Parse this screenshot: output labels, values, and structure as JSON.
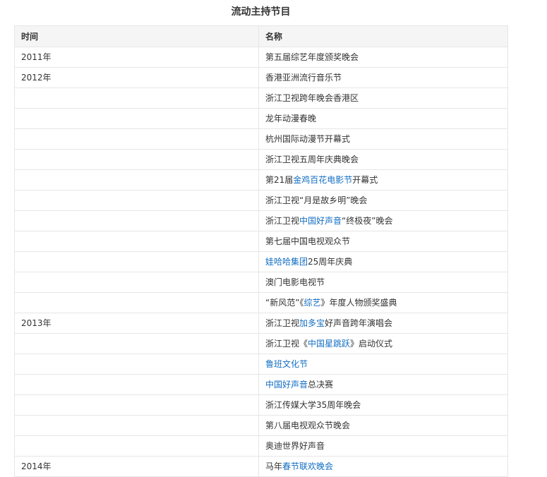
{
  "title": "流动主持节目",
  "headers": {
    "time": "时间",
    "name": "名称"
  },
  "colors": {
    "link": "#136ec2",
    "header_bg": "#f5f5f5",
    "border": "#e6e6e6"
  },
  "rows": [
    {
      "time": "2011年",
      "parts": [
        {
          "text": "第五届综艺年度颁奖晚会"
        }
      ]
    },
    {
      "time": "2012年",
      "parts": [
        {
          "text": "香港亚洲流行音乐节"
        }
      ]
    },
    {
      "time": "",
      "parts": [
        {
          "text": "浙江卫视跨年晚会香港区"
        }
      ]
    },
    {
      "time": "",
      "parts": [
        {
          "text": "龙年动漫春晚"
        }
      ]
    },
    {
      "time": "",
      "parts": [
        {
          "text": "杭州国际动漫节开幕式"
        }
      ]
    },
    {
      "time": "",
      "parts": [
        {
          "text": "浙江卫视五周年庆典晚会"
        }
      ]
    },
    {
      "time": "",
      "parts": [
        {
          "text": "第21届"
        },
        {
          "text": "金鸡百花电影节",
          "link": true
        },
        {
          "text": "开幕式"
        }
      ]
    },
    {
      "time": "",
      "parts": [
        {
          "text": "浙江卫视“月是故乡明”晚会"
        }
      ]
    },
    {
      "time": "",
      "parts": [
        {
          "text": "浙江卫视"
        },
        {
          "text": "中国好声音",
          "link": true
        },
        {
          "text": "“终极夜”晚会"
        }
      ]
    },
    {
      "time": "",
      "parts": [
        {
          "text": "第七届中国电视观众节"
        }
      ]
    },
    {
      "time": "",
      "parts": [
        {
          "text": "娃哈哈集团",
          "link": true
        },
        {
          "text": "25周年庆典"
        }
      ]
    },
    {
      "time": "",
      "parts": [
        {
          "text": "澳门电影电视节"
        }
      ]
    },
    {
      "time": "",
      "parts": [
        {
          "text": "“新风范”《"
        },
        {
          "text": "综艺",
          "link": true
        },
        {
          "text": "》年度人物颁奖盛典"
        }
      ]
    },
    {
      "time": "2013年",
      "parts": [
        {
          "text": "浙江卫视"
        },
        {
          "text": "加多宝",
          "link": true
        },
        {
          "text": "好声音跨年演唱会"
        }
      ]
    },
    {
      "time": "",
      "parts": [
        {
          "text": "浙江卫视《"
        },
        {
          "text": "中国星跳跃",
          "link": true
        },
        {
          "text": "》启动仪式"
        }
      ]
    },
    {
      "time": "",
      "parts": [
        {
          "text": "鲁班文化节",
          "link": true
        }
      ]
    },
    {
      "time": "",
      "parts": [
        {
          "text": "中国好声音",
          "link": true
        },
        {
          "text": "总决赛"
        }
      ]
    },
    {
      "time": "",
      "parts": [
        {
          "text": "浙江传媒大学35周年晚会"
        }
      ]
    },
    {
      "time": "",
      "parts": [
        {
          "text": "第八届电视观众节晚会"
        }
      ]
    },
    {
      "time": "",
      "parts": [
        {
          "text": "奥迪世界好声音"
        }
      ]
    },
    {
      "time": "2014年",
      "parts": [
        {
          "text": "马年"
        },
        {
          "text": "春节联欢晚会",
          "link": true
        }
      ]
    }
  ]
}
